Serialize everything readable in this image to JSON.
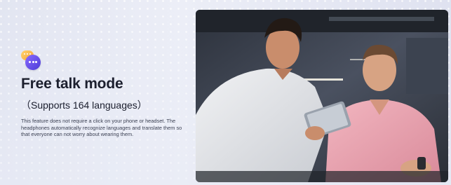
{
  "feature": {
    "title": "Free talk mode",
    "subtitle": "（Supports 164 languages）",
    "description": "This feature does not require a click on your phone or headset. The headphones automatically recognize languages and translate them so that everyone can not worry about wearing them.",
    "logo_icon": "chat-bubbles-icon"
  },
  "photo": {
    "subject": "two-men-with-tablet-photo"
  },
  "colors": {
    "accent": "#5b44e0",
    "title": "#1c1f2e",
    "body": "#3d4254"
  }
}
